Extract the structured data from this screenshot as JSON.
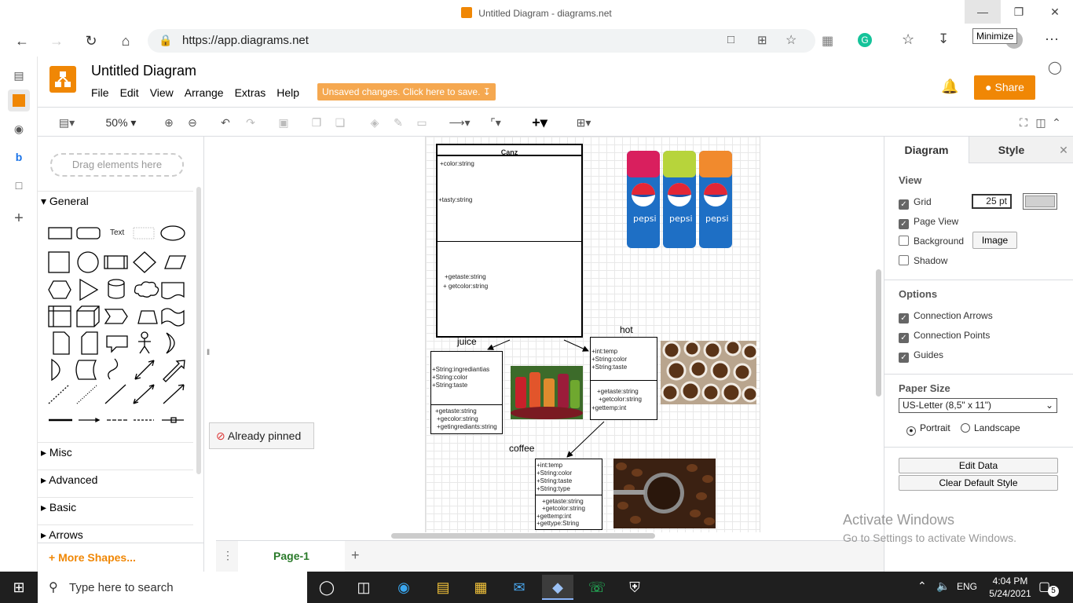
{
  "browser": {
    "window_title": "Untitled Diagram - diagrams.net",
    "url": "https://app.diagrams.net",
    "tooltip": "Minimize"
  },
  "app": {
    "title": "Untitled Diagram",
    "menu": [
      "File",
      "Edit",
      "View",
      "Arrange",
      "Extras",
      "Help"
    ],
    "unsaved": "Unsaved changes. Click here to save.",
    "share": "Share",
    "brand_color": "#f08705"
  },
  "toolbar": {
    "zoom": "50%"
  },
  "shapes_panel": {
    "drag_hint": "Drag elements here",
    "general": "General",
    "text_shape": "Text",
    "misc": "Misc",
    "advanced": "Advanced",
    "basic": "Basic",
    "arrows": "Arrows",
    "more_shapes": "More Shapes..."
  },
  "diagram": {
    "canz": {
      "title": "Canz",
      "attr1": "+color:string",
      "attr2": "+tasty:string",
      "m1": "+getaste:string",
      "m2": "+ getcolor:string"
    },
    "juice": {
      "label": "juice",
      "a1": "+String:ingrediantias",
      "a2": "+String:color",
      "a3": "+String:taste",
      "m1": "+getaste:string",
      "m2": "+gecolor:string",
      "m3": "+getingrediants:string"
    },
    "hot": {
      "label": "hot",
      "a1": "+int:temp",
      "a2": "+String:color",
      "a3": "+String:taste",
      "m1": "+getaste:string",
      "m2": "+getcolor:string",
      "m3": "+gettemp:int"
    },
    "coffee": {
      "label": "coffee",
      "a1": "+int:temp",
      "a2": "+String:color",
      "a3": "+String:taste",
      "a4": "+String:type",
      "m1": "+getaste:string",
      "m2": "+getcolor:string",
      "m3": "+gettemp:int",
      "m4": "+gettype:String"
    }
  },
  "format_panel": {
    "tab_diagram": "Diagram",
    "tab_style": "Style",
    "view": "View",
    "grid": "Grid",
    "grid_size": "25 pt",
    "page_view": "Page View",
    "background": "Background",
    "image_btn": "Image",
    "shadow": "Shadow",
    "options": "Options",
    "conn_arrows": "Connection Arrows",
    "conn_points": "Connection Points",
    "guides": "Guides",
    "paper_size": "Paper Size",
    "paper_value": "US-Letter (8,5\" x 11\")",
    "portrait": "Portrait",
    "landscape": "Landscape",
    "edit_data": "Edit Data",
    "clear_style": "Clear Default Style"
  },
  "page_tab": "Page-1",
  "popup": "Already pinned",
  "watermark": {
    "line1": "Activate Windows",
    "line2": "Go to Settings to activate Windows."
  },
  "taskbar": {
    "search": "Type here to search",
    "lang": "ENG",
    "time": "4:04 PM",
    "date": "5/24/2021",
    "notif": "5"
  }
}
